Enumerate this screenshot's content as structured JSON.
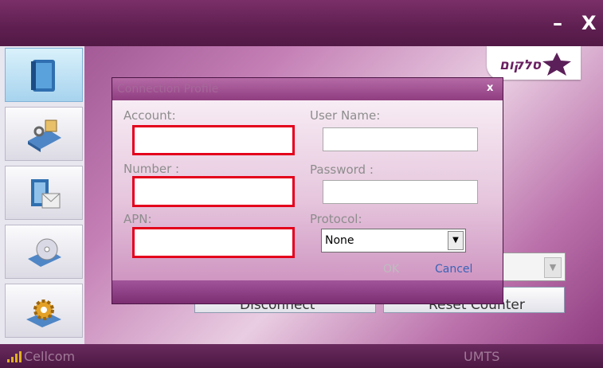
{
  "window": {
    "minimize_label": "–",
    "close_label": "X"
  },
  "logo": {
    "text": "סלקום"
  },
  "sidebar": {
    "items": [
      {
        "icon": "phonebook-icon"
      },
      {
        "icon": "connection-settings-icon"
      },
      {
        "icon": "messages-icon"
      },
      {
        "icon": "media-cd-icon"
      },
      {
        "icon": "gear-icon"
      }
    ]
  },
  "background": {
    "disconnect_label": "Disconnect",
    "reset_counter_label": "Reset Counter"
  },
  "dialog": {
    "title": "Connection Profile",
    "close_label": "x",
    "account_label": "Account:",
    "account_value": "",
    "number_label": "Number :",
    "number_value": "",
    "apn_label": "APN:",
    "apn_value": "",
    "username_label": "User Name:",
    "username_value": "",
    "password_label": "Password :",
    "password_value": "",
    "protocol_label": "Protocol:",
    "protocol_value": "None",
    "ok_label": "OK",
    "cancel_label": "Cancel"
  },
  "status": {
    "carrier": "Cellcom",
    "network": "UMTS"
  },
  "colors": {
    "highlight": "#e4001b",
    "accent": "#6a1f62"
  }
}
